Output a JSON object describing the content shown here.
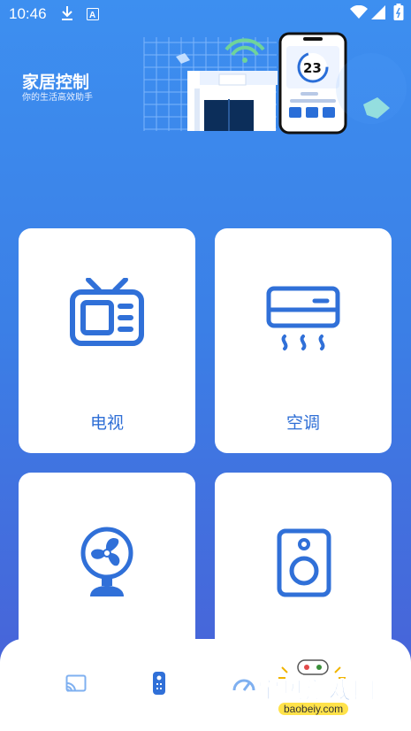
{
  "status_bar": {
    "time": "10:46"
  },
  "hero": {
    "title": "家居控制",
    "subtitle": "你的生活高效助手",
    "temperature": "23"
  },
  "cards": [
    {
      "label": "电视",
      "icon": "tv-icon"
    },
    {
      "label": "空调",
      "icon": "air-conditioner-icon"
    },
    {
      "label": "",
      "icon": "fan-icon"
    },
    {
      "label": "",
      "icon": "speaker-icon"
    }
  ],
  "nav": [
    {
      "icon": "cast-icon"
    },
    {
      "icon": "remote-icon"
    },
    {
      "icon": "gauge-icon"
    }
  ],
  "watermark": {
    "text": "宝贝游戏网",
    "url": "baobeiy.com"
  },
  "colors": {
    "accent": "#3070d8",
    "bg_top": "#3d8ff0",
    "bg_bottom": "#4a5fd6"
  }
}
